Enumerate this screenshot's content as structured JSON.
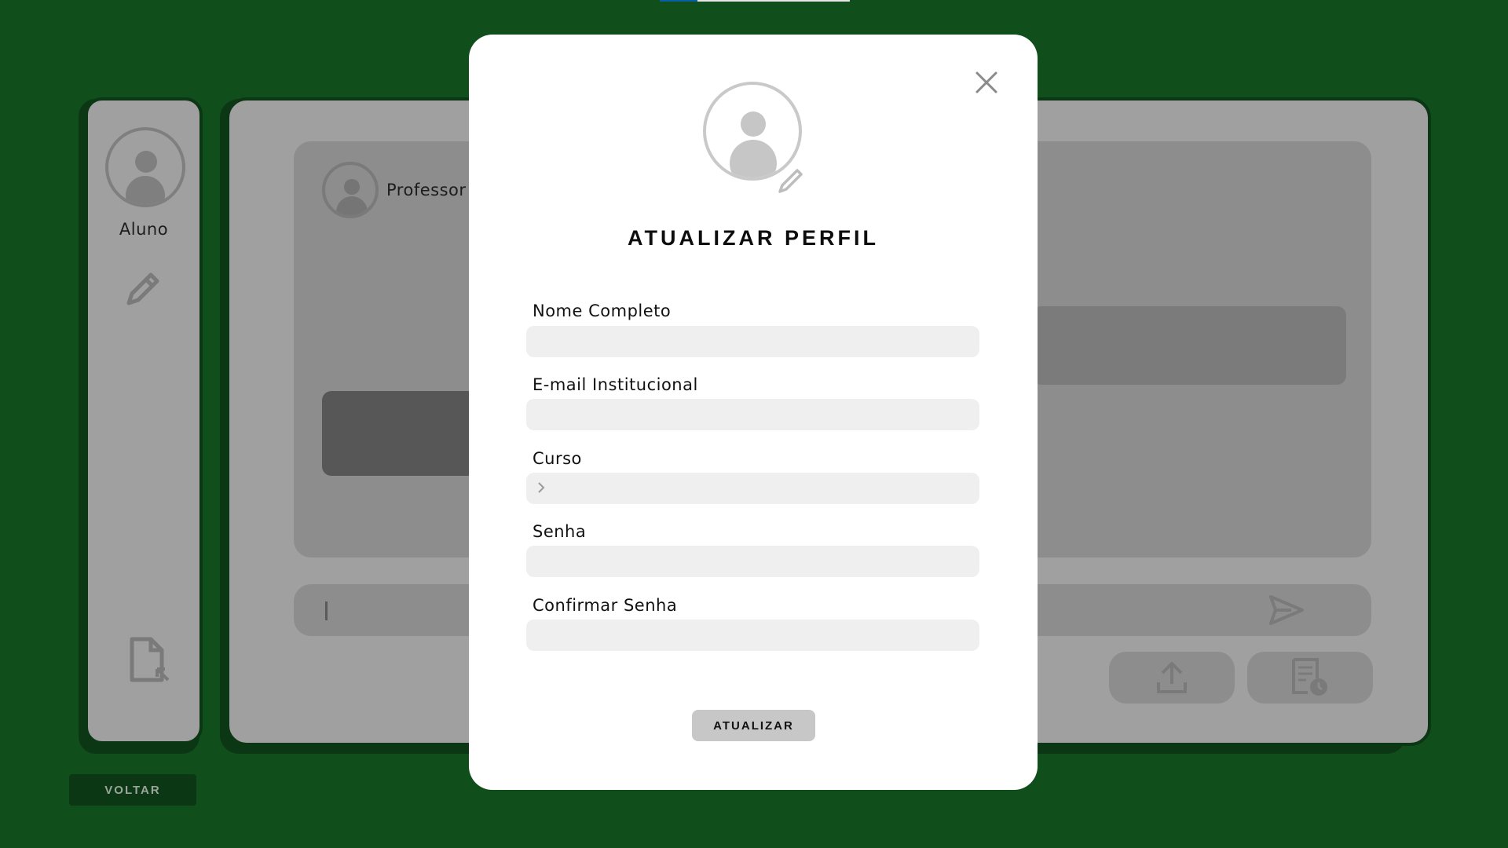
{
  "sidebar": {
    "user_label": "Aluno"
  },
  "chat": {
    "contact_name": "Professor"
  },
  "footer": {
    "back_label": "VOLTAR"
  },
  "modal": {
    "title": "ATUALIZAR PERFIL",
    "fields": [
      {
        "label": "Nome Completo",
        "value": ""
      },
      {
        "label": "E-mail Institucional",
        "value": ""
      },
      {
        "label": "Curso",
        "value": ""
      },
      {
        "label": "Senha",
        "value": ""
      },
      {
        "label": "Confirmar Senha",
        "value": ""
      }
    ],
    "submit_label": "ATUALIZAR"
  },
  "icons": {
    "close": "close-icon",
    "avatar": "user-avatar-icon",
    "edit": "pencil-icon",
    "file": "file-export-icon",
    "send": "send-icon",
    "upload": "upload-icon",
    "history": "document-history-icon",
    "chevron": "chevron-right-icon"
  },
  "colors": {
    "background": "#104e1b",
    "dark_green": "#0c3714",
    "overlay_gray": "#a0a0a0",
    "modal_bg": "#ffffff",
    "input_bg": "#efefef",
    "submit_bg": "#c7c7c7"
  }
}
